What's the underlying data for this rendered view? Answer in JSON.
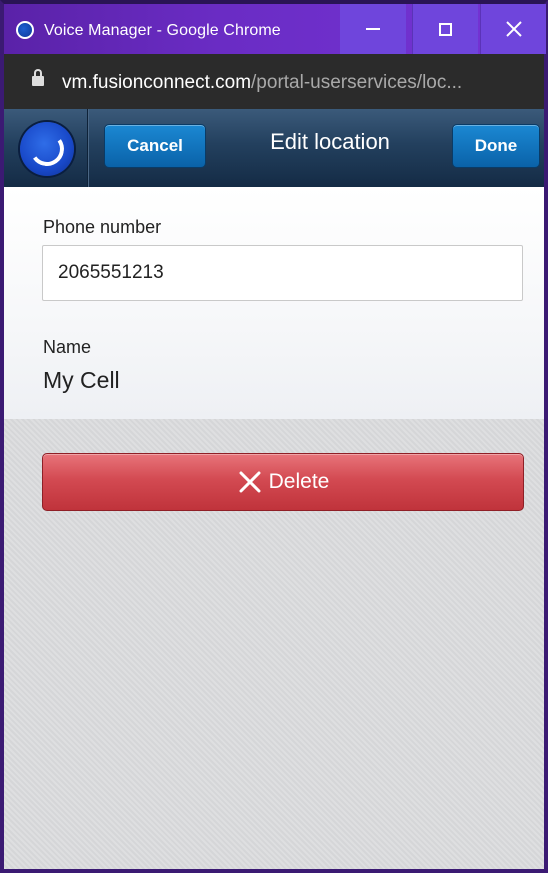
{
  "window": {
    "title": "Voice Manager - Google Chrome"
  },
  "address_bar": {
    "domain": "vm.fusionconnect.com",
    "path": "/portal-userservices/loc..."
  },
  "header": {
    "cancel_label": "Cancel",
    "title": "Edit location",
    "done_label": "Done"
  },
  "form": {
    "phone_label": "Phone number",
    "phone_value": "2065551213",
    "name_label": "Name",
    "name_value": "My Cell"
  },
  "actions": {
    "delete_label": "Delete"
  },
  "colors": {
    "titlebar": "#6a2cc4",
    "header": "#23405e",
    "primary_button": "#1b88d3",
    "delete_button": "#d34a52"
  }
}
